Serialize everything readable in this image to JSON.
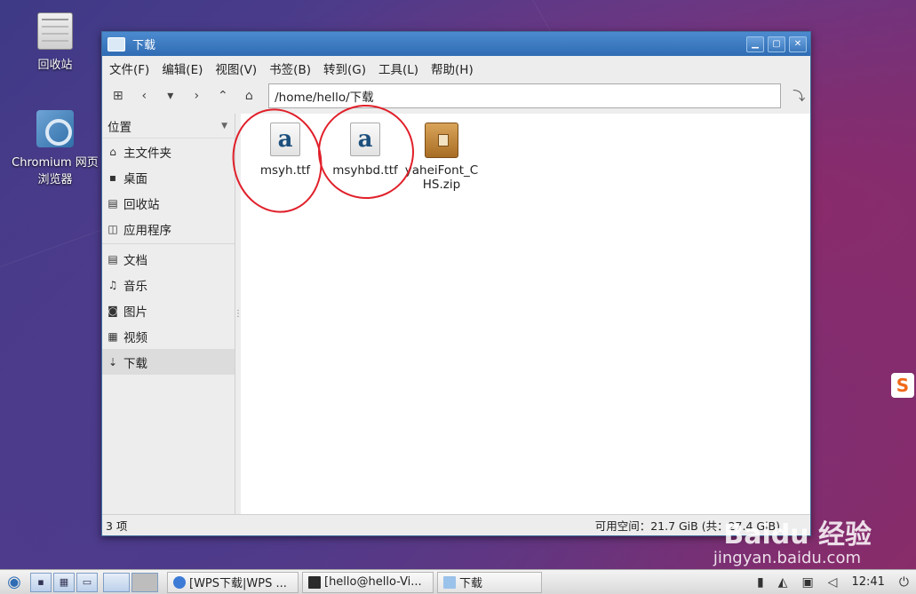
{
  "desktop": {
    "icons": [
      {
        "label": "回收站"
      },
      {
        "label": "Chromium 网页浏览器"
      }
    ]
  },
  "window": {
    "title": "下载",
    "controls": {
      "minimize": "▁",
      "maximize": "▢",
      "close": "✕"
    },
    "menu": [
      "文件(F)",
      "编辑(E)",
      "视图(V)",
      "书签(B)",
      "转到(G)",
      "工具(L)",
      "帮助(H)"
    ],
    "path": "/home/hello/下载",
    "sidebar": {
      "header": "位置",
      "places": [
        "主文件夹",
        "桌面",
        "回收站",
        "应用程序"
      ],
      "folders": [
        "文档",
        "音乐",
        "图片",
        "视频",
        "下载"
      ]
    },
    "files": [
      {
        "name": "msyh.ttf",
        "icon": "font-file-icon"
      },
      {
        "name": "msyhbd.ttf",
        "icon": "font-file-icon"
      },
      {
        "name": "yaheiFont_CHS.zip",
        "icon": "archive-icon"
      }
    ],
    "status": {
      "count": "3 项",
      "free_space": "可用空间：21.7 GiB (共：27.4 GiB)"
    }
  },
  "watermark": {
    "brand": "Baidu 经验",
    "url": "jingyan.baidu.com"
  },
  "taskbar": {
    "tasks": [
      "[WPS下载|WPS ...",
      "[hello@hello-Vi...",
      "下载"
    ],
    "clock": "12:41"
  },
  "colors": {
    "annotation": "#e0202a",
    "titlebar": "#2f6cb3"
  }
}
